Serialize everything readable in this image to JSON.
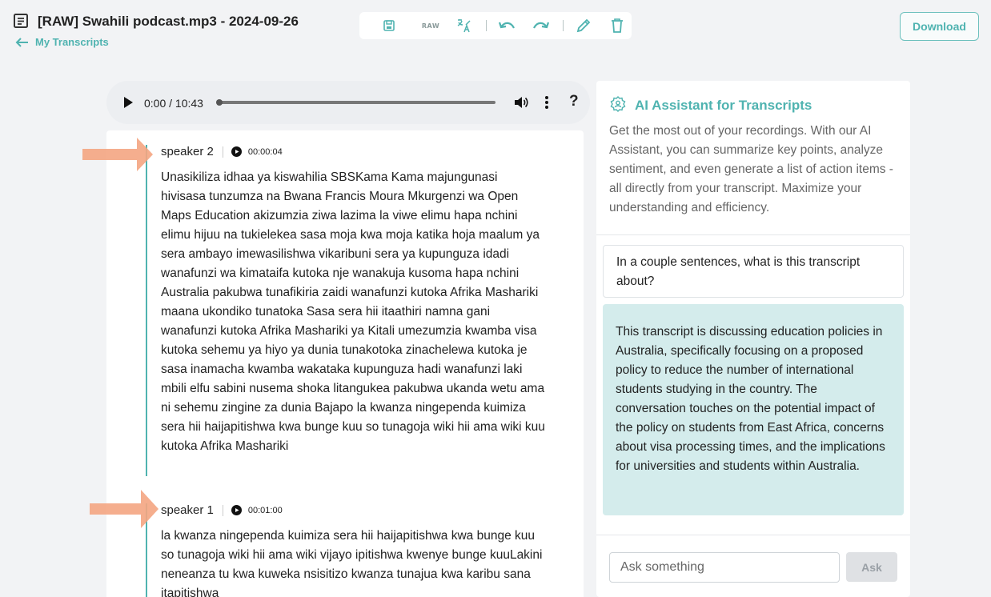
{
  "header": {
    "title": "[RAW] Swahili podcast.mp3 - 2024-09-26",
    "back_label": "My Transcripts",
    "download_label": "Download"
  },
  "toolbar": {
    "raw_label": "RAW",
    "icons": [
      "save-icon",
      "raw-icon",
      "translate-icon",
      "undo-icon",
      "redo-icon",
      "edit-icon",
      "trash-icon"
    ]
  },
  "player": {
    "time": "0:00 / 10:43",
    "progress": 0,
    "help": "?"
  },
  "transcript": {
    "segments": [
      {
        "speaker": "speaker 2",
        "timestamp": "00:00:04",
        "text": "Unasikiliza idhaa ya kiswahilia SBSKama Kama majungunasi hivisasa tunzumza na Bwana Francis Moura Mkurgenzi wa Open Maps Education akizumzia ziwa lazima la viwe elimu hapa nchini elimu hijuu na tukielekea sasa moja kwa moja katika hoja maalum ya sera ambayo imewasilishwa vikaribuni sera ya kupunguza idadi wanafunzi wa kimataifa kutoka nje wanakuja kusoma hapa nchini Australia pakubwa tunafikiria zaidi wanafunzi kutoka Afrika Mashariki maana ukondiko tunatoka Sasa sera hii itaathiri namna gani wanafunzi kutoka Afrika Mashariki ya Kitali umezumzia kwamba visa kutoka sehemu ya hiyo ya dunia tunakotoka zinachelewa kutoka je sasa inamacha kwamba wakataka kupunguza hadi wanafunzi laki mbili elfu sabini nusema shoka litangukea pakubwa ukanda wetu ama ni sehemu zingine za dunia Bajapo la kwanza ningependa kuimiza sera hii haijapitishwa kwa bunge kuu so tunagoja wiki hii ama wiki kuu kutoka Afrika Mashariki"
      },
      {
        "speaker": "speaker 1",
        "timestamp": "00:01:00",
        "text": "la kwanza ningependa kuimiza sera hii haijapitishwa kwa bunge kuu so tunagoja wiki hii ama wiki vijayo ipitishwa kwenye bunge kuuLakini neneanza tu kwa kuweka nsisitizo kwanza tunajua kwa karibu sana itapitishwa"
      }
    ]
  },
  "ai": {
    "title": "AI Assistant for Transcripts",
    "description": "Get the most out of your recordings. With our AI Assistant, you can summarize key points, analyze sentiment, and even generate a list of action items - all directly from your transcript. Maximize your understanding and efficiency.",
    "question": "In a couple sentences, what is this transcript about?",
    "answer": "This transcript is discussing education policies in Australia, specifically focusing on a proposed policy to reduce the number of international students studying in the country. The conversation touches on the potential impact of the policy on students from East Africa, concerns about visa processing times, and the implications for universities and students within Australia.",
    "input_placeholder": "Ask something",
    "ask_label": "Ask"
  },
  "colors": {
    "accent": "#4fb3b0",
    "answer_bg": "#d4ecec",
    "arrow": "#f4a582"
  }
}
